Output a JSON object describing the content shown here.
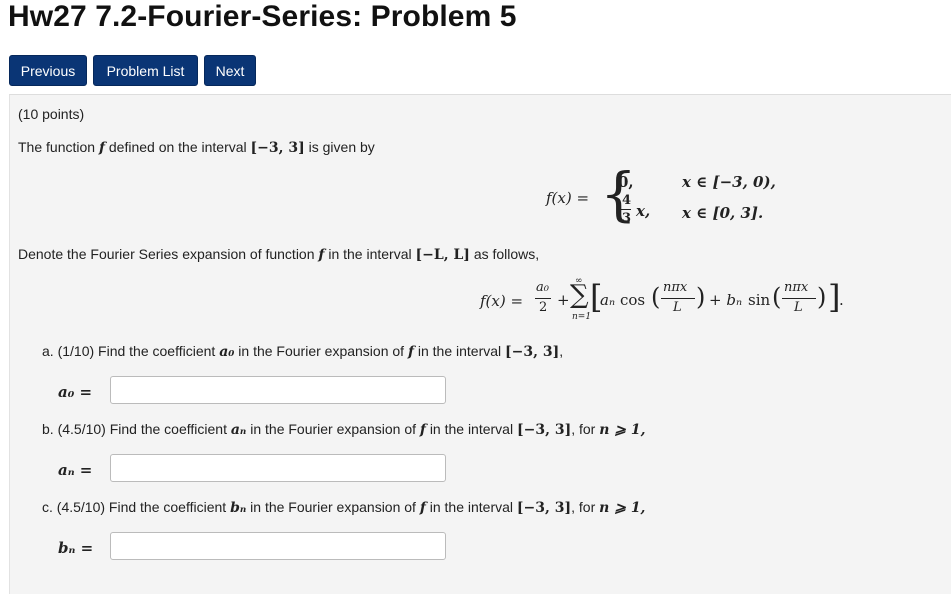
{
  "header": {
    "title": "Hw27 7.2-Fourier-Series: Problem 5"
  },
  "nav": {
    "previous": "Previous",
    "problem_list": "Problem List",
    "next": "Next"
  },
  "problem": {
    "points": "(10 points)",
    "intro_prefix": "The function",
    "intro_mid": "defined on the interval",
    "intro_interval": "[−3, 3]",
    "intro_suffix": "is given by",
    "piecewise": {
      "lhs": "f(x) =",
      "case1_value": "0,",
      "case1_condition": "x ∈ [−3, 0),",
      "case2_num": "4",
      "case2_den": "3",
      "case2_tail": "x,",
      "case2_condition": "x ∈ [0, 3]."
    },
    "denote_prefix": "Denote the Fourier Series expansion of function",
    "denote_mid": "in the interval",
    "denote_interval": "[−L, L]",
    "denote_suffix": "as follows,",
    "series": {
      "lhs": "f(x) =",
      "a0_num": "a₀",
      "a0_den": "2",
      "plus": "+",
      "sum_top": "∞",
      "sum_sym": "∑",
      "sum_bottom": "n=1",
      "an": "aₙ",
      "cos": "cos",
      "arg_num": "nπx",
      "arg_den": "L",
      "plus_bn": "+ bₙ",
      "sin": "sin"
    },
    "part_a": {
      "text_prefix": "a. (1/10) Find the coefficient",
      "coef": "a₀",
      "text_mid": "in the Fourier expansion of",
      "text_mid2": "in the interval",
      "interval": "[−3, 3]",
      "text_suffix": ",",
      "label": "a₀ =",
      "value": ""
    },
    "part_b": {
      "text_prefix": "b. (4.5/10) Find the coefficient",
      "coef": "aₙ",
      "text_mid": "in the Fourier expansion of",
      "text_mid2": "in the interval",
      "interval": "[−3, 3]",
      "text_suffix": ", for",
      "cond": "n ⩾ 1,",
      "label": "aₙ =",
      "value": ""
    },
    "part_c": {
      "text_prefix": "c. (4.5/10) Find the coefficient",
      "coef": "bₙ",
      "text_mid": "in the Fourier expansion of",
      "text_mid2": "in the interval",
      "interval": "[−3, 3]",
      "text_suffix": ", for",
      "cond": "n ⩾ 1,",
      "label": "bₙ =",
      "value": ""
    },
    "f_symbol": "f"
  }
}
